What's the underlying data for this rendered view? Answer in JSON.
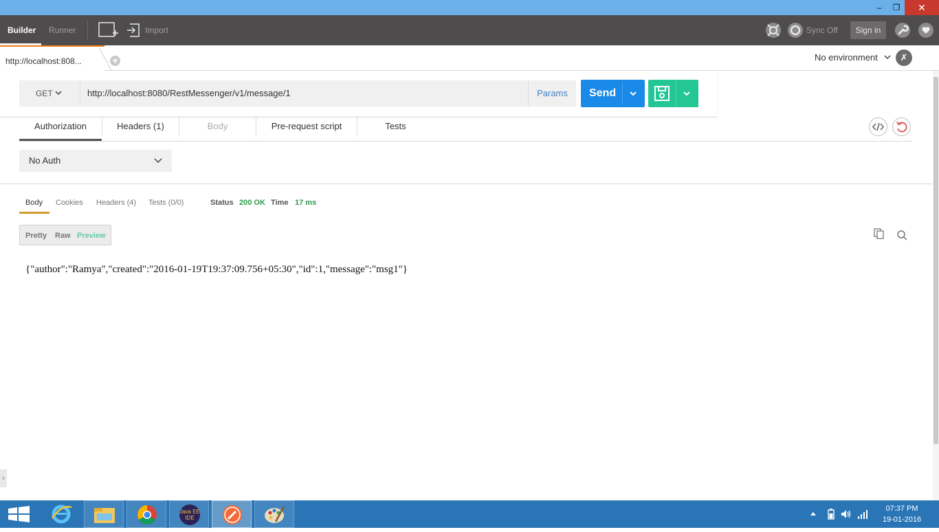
{
  "window": {
    "minimize": "–",
    "maximize": "❐",
    "close": "✕"
  },
  "toolbar": {
    "builder": "Builder",
    "runner": "Runner",
    "import": "Import",
    "sync": "Sync Off",
    "sign_in": "Sign in"
  },
  "tabs": {
    "request_tab": "http://localhost:808...",
    "add": "+"
  },
  "environment": {
    "label": "No environment",
    "settings_glyph": "✗"
  },
  "request": {
    "method": "GET",
    "url": "http://localhost:8080/RestMessenger/v1/message/1",
    "params": "Params",
    "send": "Send"
  },
  "request_tabs": {
    "authorization": "Authorization",
    "headers": "Headers (1)",
    "body": "Body",
    "pre_request": "Pre-request script",
    "tests": "Tests"
  },
  "auth": {
    "type": "No Auth"
  },
  "response": {
    "tabs": {
      "body": "Body",
      "cookies": "Cookies",
      "headers": "Headers (4)",
      "tests": "Tests (0/0)"
    },
    "status_label": "Status",
    "status_value": "200 OK",
    "time_label": "Time",
    "time_value": "17 ms",
    "modes": {
      "pretty": "Pretty",
      "raw": "Raw",
      "preview": "Preview"
    },
    "body_text": "{\"author\":\"Ramya\",\"created\":\"2016-01-19T19:37:09.756+05:30\",\"id\":1,\"message\":\"msg1\"}"
  },
  "taskbar": {
    "apps": [
      "windows-start",
      "internet-explorer",
      "file-explorer",
      "google-chrome",
      "java-ee-ide",
      "postman",
      "paint"
    ],
    "java_label": "Java EE IDE",
    "time": "07:37 PM",
    "date": "19-01-2016"
  },
  "colors": {
    "send_button": "#1a8ae8",
    "save_button": "#22c793",
    "status_ok": "#2e9a4b",
    "active_tab_accent": "#f07f1b",
    "taskbar": "#2a75b5"
  }
}
